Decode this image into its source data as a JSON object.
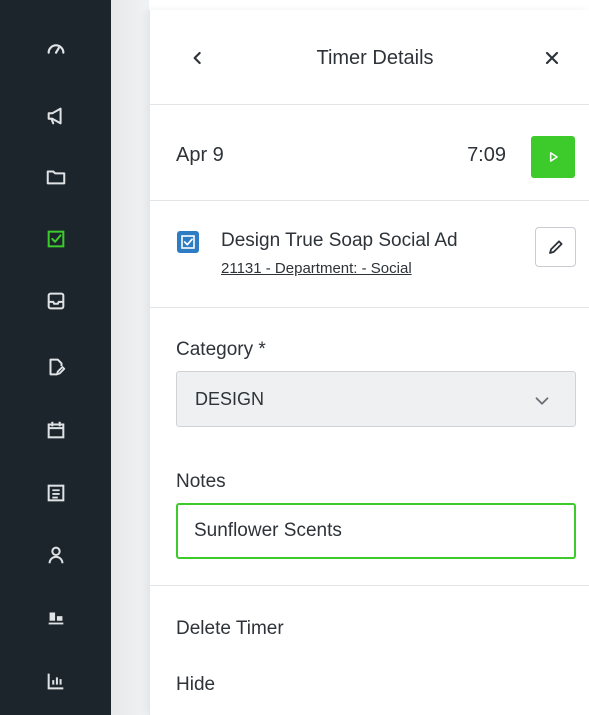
{
  "sidebar": {
    "items": [
      {
        "icon": "dashboard-icon",
        "active": false
      },
      {
        "icon": "megaphone-icon",
        "active": false
      },
      {
        "icon": "folder-icon",
        "active": false
      },
      {
        "icon": "task-check-icon",
        "active": true
      },
      {
        "icon": "inbox-icon",
        "active": false
      },
      {
        "icon": "document-edit-icon",
        "active": false
      },
      {
        "icon": "calendar-icon",
        "active": false
      },
      {
        "icon": "list-icon",
        "active": false
      },
      {
        "icon": "person-icon",
        "active": false
      },
      {
        "icon": "team-icon",
        "active": false
      },
      {
        "icon": "bar-chart-icon",
        "active": false
      }
    ],
    "colors": {
      "bg": "#1c252c",
      "icon": "#dfe3e6",
      "active": "#3dca2b"
    }
  },
  "panel": {
    "title": "Timer Details",
    "date": "Apr 9",
    "time": "7:09",
    "task": {
      "title": "Design True Soap Social Ad",
      "subtitle": "21131 - Department: - Social"
    },
    "category": {
      "label": "Category *",
      "value": "DESIGN"
    },
    "notes": {
      "label": "Notes",
      "value": "Sunflower Scents"
    },
    "actions": {
      "delete": "Delete Timer",
      "hide": "Hide"
    },
    "colors": {
      "accent_green": "#3dca2b",
      "task_blue": "#2e7cc4"
    }
  }
}
